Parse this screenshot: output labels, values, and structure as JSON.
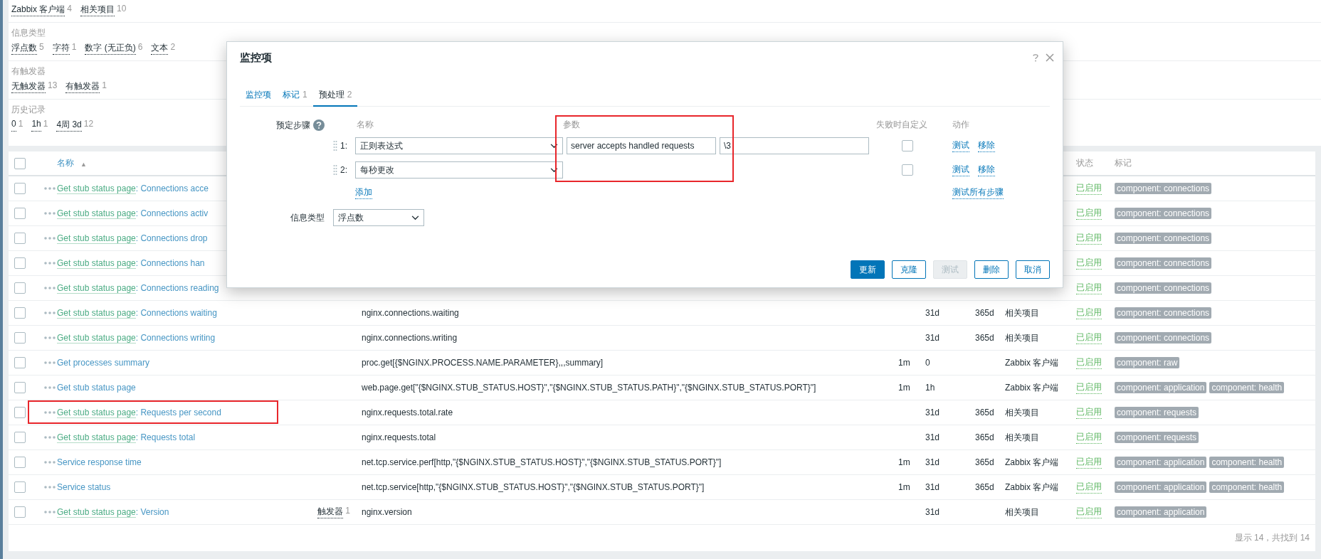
{
  "filter": {
    "groups": [
      {
        "items": [
          {
            "label": "Zabbix 客户端",
            "count": "4"
          },
          {
            "label": "相关项目",
            "count": "10"
          }
        ]
      },
      {
        "title": "信息类型",
        "items": [
          {
            "label": "浮点数",
            "count": "5"
          },
          {
            "label": "字符",
            "count": "1"
          },
          {
            "label": "数字 (无正负)",
            "count": "6"
          },
          {
            "label": "文本",
            "count": "2"
          }
        ]
      },
      {
        "title": "有触发器",
        "items": [
          {
            "label": "无触发器",
            "count": "13"
          },
          {
            "label": "有触发器",
            "count": "1"
          }
        ]
      },
      {
        "title": "历史记录",
        "items": [
          {
            "label": "0",
            "count": "1"
          },
          {
            "label": "1h",
            "count": "1"
          },
          {
            "label": "4周 3d",
            "count": "12"
          }
        ]
      }
    ]
  },
  "table": {
    "header": {
      "checked": false,
      "name": "名称",
      "sort_indicator": "▲",
      "status": "状态",
      "tags": "标记"
    },
    "name_separator": ":",
    "rows": [
      {
        "checked": false,
        "template": "Get stub status page",
        "name": "Connections acce",
        "status": "已启用",
        "tags": [
          "component: connections"
        ],
        "highlighted": false
      },
      {
        "checked": false,
        "template": "Get stub status page",
        "name": "Connections activ",
        "status": "已启用",
        "tags": [
          "component: connections"
        ],
        "highlighted": false
      },
      {
        "checked": false,
        "template": "Get stub status page",
        "name": "Connections drop",
        "status": "已启用",
        "tags": [
          "component: connections"
        ],
        "highlighted": false
      },
      {
        "checked": false,
        "template": "Get stub status page",
        "name": "Connections han",
        "status": "已启用",
        "tags": [
          "component: connections"
        ],
        "highlighted": false
      },
      {
        "checked": false,
        "template": "Get stub status page",
        "name": "Connections reading",
        "status": "已启用",
        "tags": [
          "component: connections"
        ],
        "highlighted": false
      },
      {
        "checked": false,
        "template": "Get stub status page",
        "name": "Connections waiting",
        "key": "nginx.connections.waiting",
        "history": "31d",
        "trends": "365d",
        "type": "相关项目",
        "status": "已启用",
        "tags": [
          "component: connections"
        ],
        "highlighted": false
      },
      {
        "checked": false,
        "template": "Get stub status page",
        "name": "Connections writing",
        "key": "nginx.connections.writing",
        "history": "31d",
        "trends": "365d",
        "type": "相关项目",
        "status": "已启用",
        "tags": [
          "component: connections"
        ],
        "highlighted": false
      },
      {
        "checked": false,
        "name": "Get processes summary",
        "key": "proc.get[{$NGINX.PROCESS.NAME.PARAMETER},,,summary]",
        "interval": "1m",
        "history": "0",
        "type": "Zabbix 客户端",
        "status": "已启用",
        "tags": [
          "component: raw"
        ],
        "highlighted": false
      },
      {
        "checked": false,
        "name": "Get stub status page",
        "key": "web.page.get[\"{$NGINX.STUB_STATUS.HOST}\",\"{$NGINX.STUB_STATUS.PATH}\",\"{$NGINX.STUB_STATUS.PORT}\"]",
        "interval": "1m",
        "history": "1h",
        "type": "Zabbix 客户端",
        "status": "已启用",
        "tags": [
          "component: application",
          "component: health"
        ],
        "highlighted": false
      },
      {
        "checked": false,
        "template": "Get stub status page",
        "name": "Requests per second",
        "key": "nginx.requests.total.rate",
        "history": "31d",
        "trends": "365d",
        "type": "相关项目",
        "status": "已启用",
        "tags": [
          "component: requests"
        ],
        "highlighted": true
      },
      {
        "checked": false,
        "template": "Get stub status page",
        "name": "Requests total",
        "key": "nginx.requests.total",
        "history": "31d",
        "trends": "365d",
        "type": "相关项目",
        "status": "已启用",
        "tags": [
          "component: requests"
        ],
        "highlighted": false
      },
      {
        "checked": false,
        "name": "Service response time",
        "key": "net.tcp.service.perf[http,\"{$NGINX.STUB_STATUS.HOST}\",\"{$NGINX.STUB_STATUS.PORT}\"]",
        "interval": "1m",
        "history": "31d",
        "trends": "365d",
        "type": "Zabbix 客户端",
        "status": "已启用",
        "tags": [
          "component: application",
          "component: health"
        ],
        "highlighted": false
      },
      {
        "checked": false,
        "name": "Service status",
        "key": "net.tcp.service[http,\"{$NGINX.STUB_STATUS.HOST}\",\"{$NGINX.STUB_STATUS.PORT}\"]",
        "interval": "1m",
        "history": "31d",
        "trends": "365d",
        "type": "Zabbix 客户端",
        "status": "已启用",
        "tags": [
          "component: application",
          "component: health"
        ],
        "highlighted": false
      },
      {
        "checked": false,
        "template": "Get stub status page",
        "name": "Version",
        "triggers": {
          "label": "触发器",
          "count": "1"
        },
        "key": "nginx.version",
        "history": "31d",
        "type": "相关项目",
        "status": "已启用",
        "tags": [
          "component: application"
        ],
        "highlighted": false
      }
    ],
    "footer": "显示 14，共找到 14"
  },
  "dialog": {
    "title": "监控项",
    "tabs": [
      {
        "label": "监控项",
        "selected": false
      },
      {
        "label": "标记",
        "count": "1",
        "selected": false
      },
      {
        "label": "预处理",
        "count": "2",
        "selected": true
      }
    ],
    "steps_label": "预定步骤",
    "columns": [
      "名称",
      "参数",
      "失败时自定义",
      "动作"
    ],
    "steps": [
      {
        "index": "1:",
        "type": "正则表达式",
        "params": [
          "server accepts handled requests",
          "\\3"
        ],
        "custom_on_fail": false,
        "actions": [
          "测试",
          "移除"
        ]
      },
      {
        "index": "2:",
        "type": "每秒更改",
        "custom_on_fail": false,
        "actions": [
          "测试",
          "移除"
        ]
      }
    ],
    "add_link": "添加",
    "test_all_link": "测试所有步骤",
    "params_highlighted": true,
    "info_type": {
      "label": "信息类型",
      "value": "浮点数"
    },
    "buttons": [
      {
        "label": "更新",
        "kind": "primary",
        "disabled": false
      },
      {
        "label": "克隆",
        "kind": "secondary",
        "disabled": false
      },
      {
        "label": "测试",
        "kind": "secondary",
        "disabled": true
      },
      {
        "label": "删除",
        "kind": "secondary",
        "disabled": false
      },
      {
        "label": "取消",
        "kind": "secondary",
        "disabled": false
      }
    ]
  }
}
